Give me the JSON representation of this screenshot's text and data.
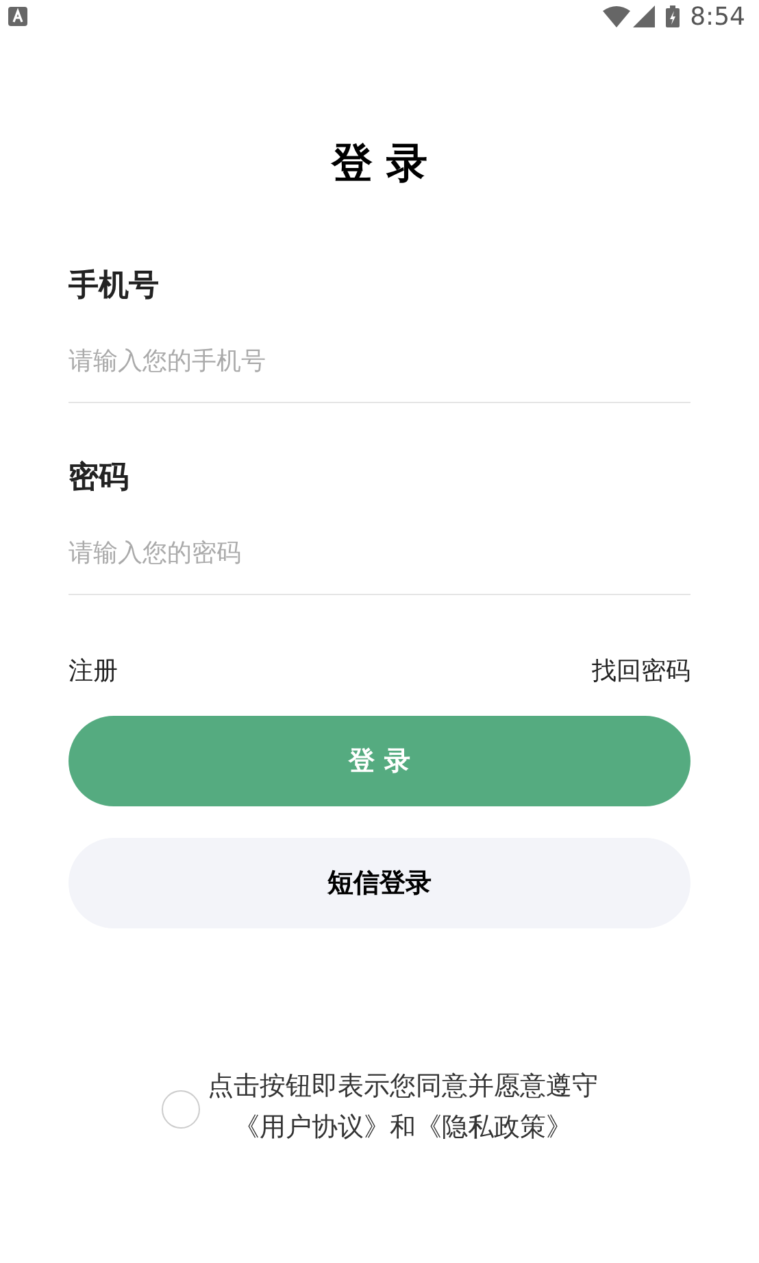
{
  "status_bar": {
    "time": "8:54"
  },
  "title": "登 录",
  "fields": [
    {
      "label": "手机号",
      "placeholder": "请输入您的手机号"
    },
    {
      "label": "密码",
      "placeholder": "请输入您的密码"
    }
  ],
  "links": [
    "注册",
    "找回密码"
  ],
  "buttons": [
    {
      "label": "登 录",
      "kind": "primary"
    },
    {
      "label": "短信登录",
      "kind": "secondary"
    }
  ],
  "agreement": {
    "checked": false,
    "lines": [
      "点击按钮即表示您同意并愿意遵守",
      "《用户协议》和《隐私政策》"
    ]
  }
}
